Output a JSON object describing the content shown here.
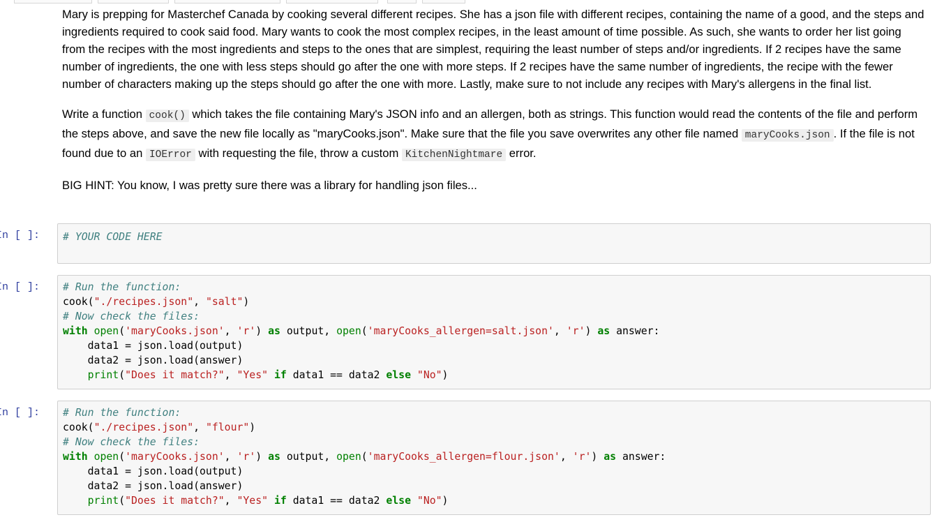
{
  "markdown": {
    "para1": "Mary is prepping for Masterchef Canada by cooking several different recipes. She has a json file with different recipes, containing the name of a good, and the steps and ingredients required to cook said food. Mary wants to cook the most complex recipes, in the least amount of time possible. As such, she wants to order her list going from the recipes with the most ingredients and steps to the ones that are simplest, requiring the least number of steps and/or ingredients. If 2 recipes have the same number of ingredients, the one with less steps should go after the one with more steps. If 2 recipes have the same number of ingredients, the recipe with the fewer number of characters making up the steps should go after the one with more. Lastly, make sure to not include any recipes with Mary's allergens in the final list.",
    "para2": {
      "t1": "Write a function ",
      "c1": "cook()",
      "t2": " which takes the file containing Mary's JSON info and an allergen, both as strings. This function would read the contents of the file and perform the steps above, and save the new file locally as \"maryCooks.json\". Make sure that the file you save overwrites any other file named ",
      "c2": "maryCooks.json",
      "t3": ". If the file is not found due to an ",
      "c3": "IOError",
      "t4": " with requesting the file, throw a custom ",
      "c4": "KitchenNightmare",
      "t5": " error."
    },
    "para3": "BIG HINT: You know, I was pretty sure there was a library for handling json files..."
  },
  "cells": {
    "prompt": "In [ ]:",
    "cell1": {
      "comment": "# YOUR CODE HERE"
    },
    "cell2": {
      "c_run": "# Run the function:",
      "call_fn": "cook",
      "call_open": "(",
      "call_arg1": "\"./recipes.json\"",
      "call_sep": ", ",
      "call_arg2": "\"salt\"",
      "call_close": ")",
      "c_check": "# Now check the files:",
      "with_kw": "with",
      "open1": "open",
      "file1": "'maryCooks.json'",
      "mode1": "'r'",
      "as_kw": "as",
      "var_output": "output",
      "open2": "open",
      "file2": "'maryCooks_allergen=salt.json'",
      "mode2": "'r'",
      "var_answer": "answer",
      "data1_line": "data1 = json.load(output)",
      "data2_line": "data2 = json.load(answer)",
      "print_fn": "print",
      "print_s1": "\"Does it match?\"",
      "print_s2": "\"Yes\"",
      "if_kw": "if",
      "cmp": "data1 == data2",
      "else_kw": "else",
      "print_s3": "\"No\""
    },
    "cell3": {
      "c_run": "# Run the function:",
      "call_fn": "cook",
      "call_arg1": "\"./recipes.json\"",
      "call_arg2": "\"flour\"",
      "c_check": "# Now check the files:",
      "file1": "'maryCooks.json'",
      "file2": "'maryCooks_allergen=flour.json'",
      "mode": "'r'",
      "data1_line": "data1 = json.load(output)",
      "data2_line": "data2 = json.load(answer)",
      "print_s1": "\"Does it match?\"",
      "print_s2": "\"Yes\"",
      "print_s3": "\"No\""
    }
  }
}
